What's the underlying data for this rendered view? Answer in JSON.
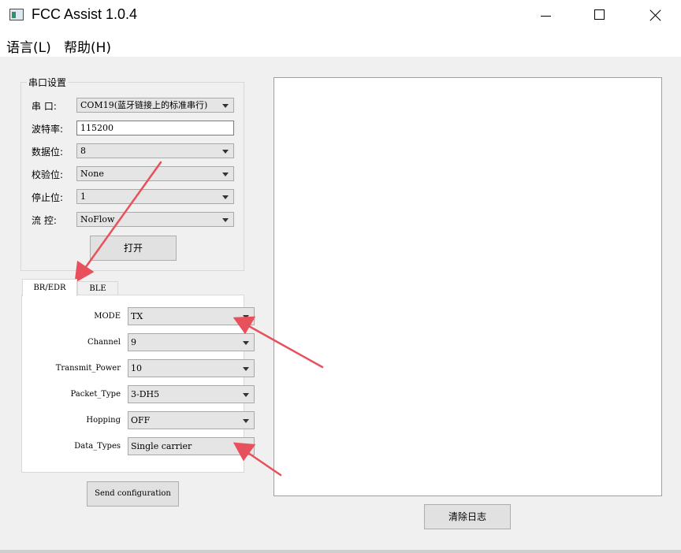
{
  "window": {
    "title": "FCC Assist 1.0.4",
    "icon": "app-icon"
  },
  "menu": [
    {
      "label": "语言(L)"
    },
    {
      "label": "帮助(H)"
    }
  ],
  "serial": {
    "group_title": "串口设置",
    "port": {
      "label": "串  口:",
      "value": "COM19(蓝牙链接上的标准串行)"
    },
    "baud": {
      "label": "波特率:",
      "value": "115200"
    },
    "data_bits": {
      "label": "数据位:",
      "value": "8"
    },
    "parity": {
      "label": "校验位:",
      "value": "None"
    },
    "stop_bits": {
      "label": "停止位:",
      "value": "1"
    },
    "flow": {
      "label": "流  控:",
      "value": "NoFlow"
    },
    "open_button": "打开"
  },
  "tabs": [
    {
      "label": "BR/EDR",
      "active": true
    },
    {
      "label": "BLE",
      "active": false
    }
  ],
  "config": {
    "mode": {
      "label": "MODE",
      "value": "TX"
    },
    "channel": {
      "label": "Channel",
      "value": "9"
    },
    "power": {
      "label": "Transmit_Power",
      "value": "10"
    },
    "packet": {
      "label": "Packet_Type",
      "value": "3-DH5"
    },
    "hopping": {
      "label": "Hopping",
      "value": "OFF"
    },
    "data_types": {
      "label": "Data_Types",
      "value": "Single carrier"
    }
  },
  "send_button": "Send configuration",
  "clear_log_button": "清除日志",
  "colors": {
    "annotation_arrow": "#e8505b",
    "window_bg": "#f0f0f0",
    "combo_bg": "#e5e5e5"
  }
}
